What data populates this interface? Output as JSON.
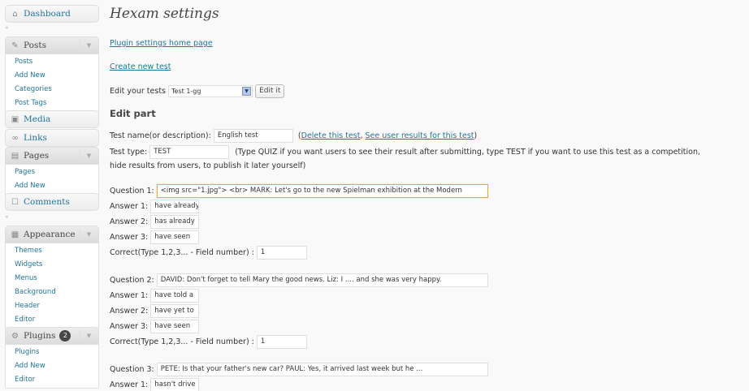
{
  "sidebar": {
    "dashboard": "Dashboard",
    "posts": {
      "label": "Posts",
      "items": [
        "Posts",
        "Add New",
        "Categories",
        "Post Tags"
      ]
    },
    "media": "Media",
    "links": "Links",
    "pages": {
      "label": "Pages",
      "items": [
        "Pages",
        "Add New"
      ]
    },
    "comments": "Comments",
    "appearance": {
      "label": "Appearance",
      "items": [
        "Themes",
        "Widgets",
        "Menus",
        "Background",
        "Header",
        "Editor"
      ]
    },
    "plugins": {
      "label": "Plugins",
      "badge": "2",
      "items": [
        "Plugins",
        "Add New",
        "Editor"
      ]
    }
  },
  "main": {
    "title": "Hexam settings",
    "home_link": "Plugin settings home page",
    "create_link": "Create new test ",
    "edit_tests_label": "Edit your tests",
    "selected_test": "Test 1-gg",
    "edit_button": "Edit it",
    "edit_part_heading": "Edit part",
    "test_name_label": "Test name(or description):",
    "test_name_value": "English test",
    "delete_link": "Delete this test",
    "results_link": "See user results for this test",
    "paren_open": "(",
    "comma": ", ",
    "paren_close": ")",
    "test_type_label": "Test type:",
    "test_type_value": "TEST",
    "test_type_help_1": "(Type QUIZ if you want users to see their result after submitting, type TEST if you want to use this test as a competition,",
    "test_type_help_2": "hide results from users, to publish it later yourself)",
    "correct_label": "Correct(Type 1,2,3... - Field number) :",
    "questions": [
      {
        "label": "Question 1:",
        "value": "<img src=\"1.jpg\"> <br> MARK: Let's go to the new Spielman exhibition at the Modern",
        "answers": [
          {
            "label": "Answer 1:",
            "value": "have already"
          },
          {
            "label": "Answer 2:",
            "value": "has already"
          },
          {
            "label": "Answer 3:",
            "value": "have seen"
          }
        ],
        "correct": "1"
      },
      {
        "label": "Question 2:",
        "value": "DAVID: Don't forget to tell Mary the good news. Liz: I .... and she was very happy.",
        "answers": [
          {
            "label": "Answer 1:",
            "value": "have told a"
          },
          {
            "label": "Answer 2:",
            "value": "have yet to"
          },
          {
            "label": "Answer 3:",
            "value": "have seen"
          }
        ],
        "correct": "1"
      },
      {
        "label": "Question 3:",
        "value": "PETE: Is that your father's new car? PAUL: Yes, it arrived last week but he ...",
        "answers": [
          {
            "label": "Answer 1:",
            "value": "hasn't drive"
          }
        ]
      }
    ]
  }
}
